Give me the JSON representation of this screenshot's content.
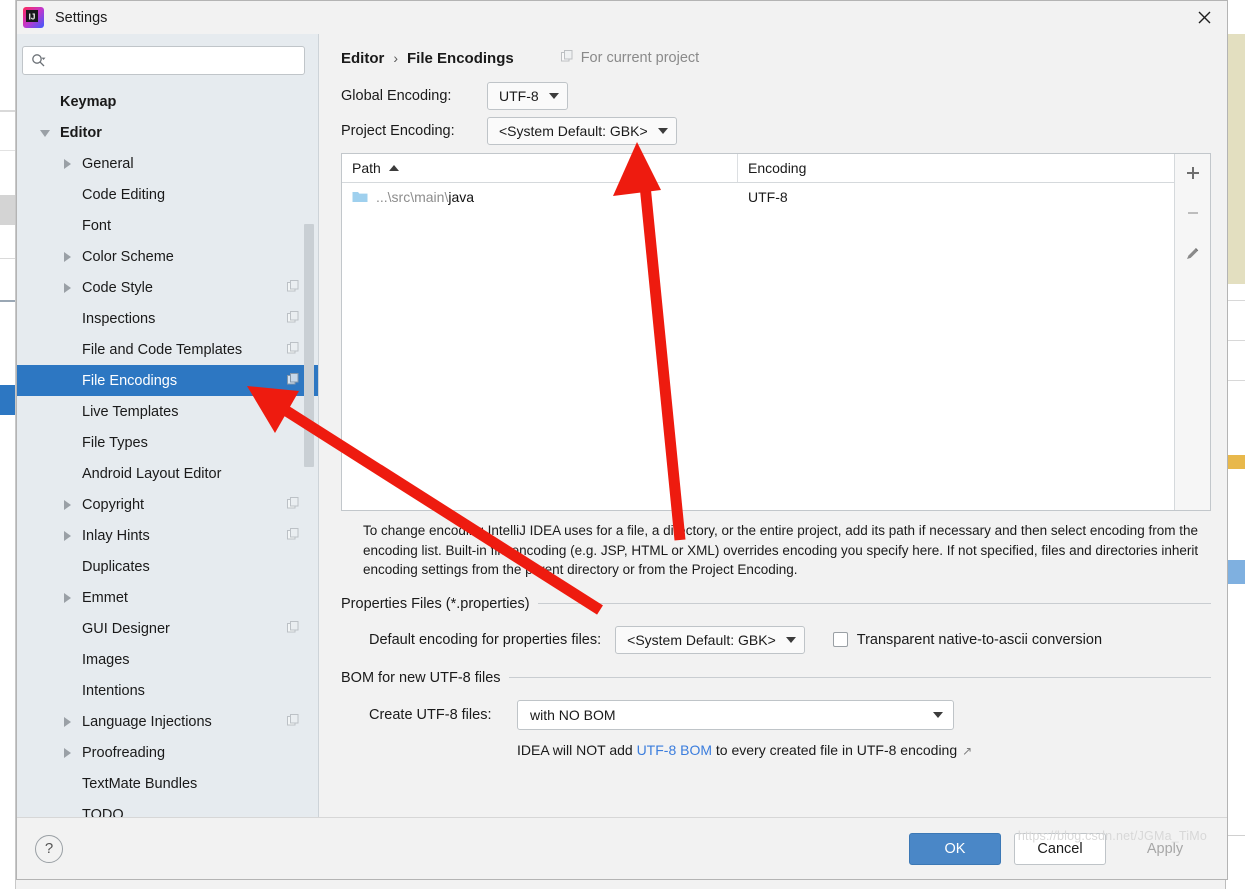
{
  "window": {
    "title": "Settings",
    "logo_icon": "intellij-idea-logo",
    "close_icon": "close-icon"
  },
  "sidebar": {
    "search": {
      "placeholder": "",
      "value": "",
      "icon": "search-icon"
    },
    "items": [
      {
        "label": "Keymap",
        "indent": 0,
        "arrow": "none",
        "bold": true,
        "badge": false,
        "selected": false
      },
      {
        "label": "Editor",
        "indent": 0,
        "arrow": "expanded",
        "bold": true,
        "badge": false,
        "selected": false
      },
      {
        "label": "General",
        "indent": 1,
        "arrow": "collapsed",
        "bold": false,
        "badge": false,
        "selected": false
      },
      {
        "label": "Code Editing",
        "indent": 1,
        "arrow": "none",
        "bold": false,
        "badge": false,
        "selected": false
      },
      {
        "label": "Font",
        "indent": 1,
        "arrow": "none",
        "bold": false,
        "badge": false,
        "selected": false
      },
      {
        "label": "Color Scheme",
        "indent": 1,
        "arrow": "collapsed",
        "bold": false,
        "badge": false,
        "selected": false
      },
      {
        "label": "Code Style",
        "indent": 1,
        "arrow": "collapsed",
        "bold": false,
        "badge": true,
        "selected": false
      },
      {
        "label": "Inspections",
        "indent": 1,
        "arrow": "none",
        "bold": false,
        "badge": true,
        "selected": false
      },
      {
        "label": "File and Code Templates",
        "indent": 1,
        "arrow": "none",
        "bold": false,
        "badge": true,
        "selected": false
      },
      {
        "label": "File Encodings",
        "indent": 1,
        "arrow": "none",
        "bold": false,
        "badge": true,
        "selected": true
      },
      {
        "label": "Live Templates",
        "indent": 1,
        "arrow": "none",
        "bold": false,
        "badge": false,
        "selected": false
      },
      {
        "label": "File Types",
        "indent": 1,
        "arrow": "none",
        "bold": false,
        "badge": false,
        "selected": false
      },
      {
        "label": "Android Layout Editor",
        "indent": 1,
        "arrow": "none",
        "bold": false,
        "badge": false,
        "selected": false
      },
      {
        "label": "Copyright",
        "indent": 1,
        "arrow": "collapsed",
        "bold": false,
        "badge": true,
        "selected": false
      },
      {
        "label": "Inlay Hints",
        "indent": 1,
        "arrow": "collapsed",
        "bold": false,
        "badge": true,
        "selected": false
      },
      {
        "label": "Duplicates",
        "indent": 1,
        "arrow": "none",
        "bold": false,
        "badge": false,
        "selected": false
      },
      {
        "label": "Emmet",
        "indent": 1,
        "arrow": "collapsed",
        "bold": false,
        "badge": false,
        "selected": false
      },
      {
        "label": "GUI Designer",
        "indent": 1,
        "arrow": "none",
        "bold": false,
        "badge": true,
        "selected": false
      },
      {
        "label": "Images",
        "indent": 1,
        "arrow": "none",
        "bold": false,
        "badge": false,
        "selected": false
      },
      {
        "label": "Intentions",
        "indent": 1,
        "arrow": "none",
        "bold": false,
        "badge": false,
        "selected": false
      },
      {
        "label": "Language Injections",
        "indent": 1,
        "arrow": "collapsed",
        "bold": false,
        "badge": true,
        "selected": false
      },
      {
        "label": "Proofreading",
        "indent": 1,
        "arrow": "collapsed",
        "bold": false,
        "badge": false,
        "selected": false
      },
      {
        "label": "TextMate Bundles",
        "indent": 1,
        "arrow": "none",
        "bold": false,
        "badge": false,
        "selected": false
      },
      {
        "label": "TODO",
        "indent": 1,
        "arrow": "none",
        "bold": false,
        "badge": false,
        "selected": false
      }
    ]
  },
  "breadcrumb": {
    "parent": "Editor",
    "separator": "›",
    "current": "File Encodings",
    "scope_note": "For current project",
    "scope_icon": "copy-badge-icon"
  },
  "encodings": {
    "global_label": "Global Encoding:",
    "global_value": "UTF-8",
    "project_label": "Project Encoding:",
    "project_value": "<System Default: GBK>"
  },
  "table": {
    "columns": [
      "Path",
      "Encoding"
    ],
    "sort_column": "Path",
    "sort_direction": "asc",
    "rows": [
      {
        "path_prefix": "...\\src\\main\\",
        "path_name": "java",
        "encoding": "UTF-8",
        "icon": "folder-icon"
      }
    ],
    "toolbar": [
      {
        "icon": "plus-icon",
        "name": "add-path-button"
      },
      {
        "icon": "minus-icon",
        "name": "remove-path-button"
      },
      {
        "icon": "pencil-icon",
        "name": "edit-path-button"
      }
    ]
  },
  "description": "To change encoding IntelliJ IDEA uses for a file, a directory, or the entire project, add its path if necessary and then select encoding from the encoding list. Built-in file encoding (e.g. JSP, HTML or XML) overrides encoding you specify here. If not specified, files and directories inherit encoding settings from the parent directory or from the Project Encoding.",
  "properties_group": {
    "title": "Properties Files (*.properties)",
    "default_encoding_label": "Default encoding for properties files:",
    "default_encoding_value": "<System Default: GBK>",
    "checkbox_label": "Transparent native-to-ascii conversion",
    "checkbox_checked": false
  },
  "bom_group": {
    "title": "BOM for new UTF-8 files",
    "create_label": "Create UTF-8 files:",
    "create_value": "with NO BOM",
    "hint_before": "IDEA will NOT add ",
    "hint_link": "UTF-8 BOM",
    "hint_after": " to every created file in UTF-8 encoding",
    "external_link_icon": "external-link-icon"
  },
  "footer": {
    "help_label": "?",
    "ok_label": "OK",
    "cancel_label": "Cancel",
    "apply_label": "Apply",
    "apply_enabled": false
  },
  "watermark": "https://blog.csdn.net/JGMa_TiMo",
  "colors": {
    "accent_selected": "#2d77c2",
    "primary_button": "#4a87c7",
    "link": "#3b7ddd",
    "sidebar_bg": "#e6ebef",
    "annotation_arrow": "#ee1b0f"
  },
  "annotations": [
    {
      "name": "arrow-to-project-encoding",
      "color": "#ee1b0f"
    },
    {
      "name": "arrow-to-file-encodings-item",
      "color": "#ee1b0f"
    }
  ]
}
